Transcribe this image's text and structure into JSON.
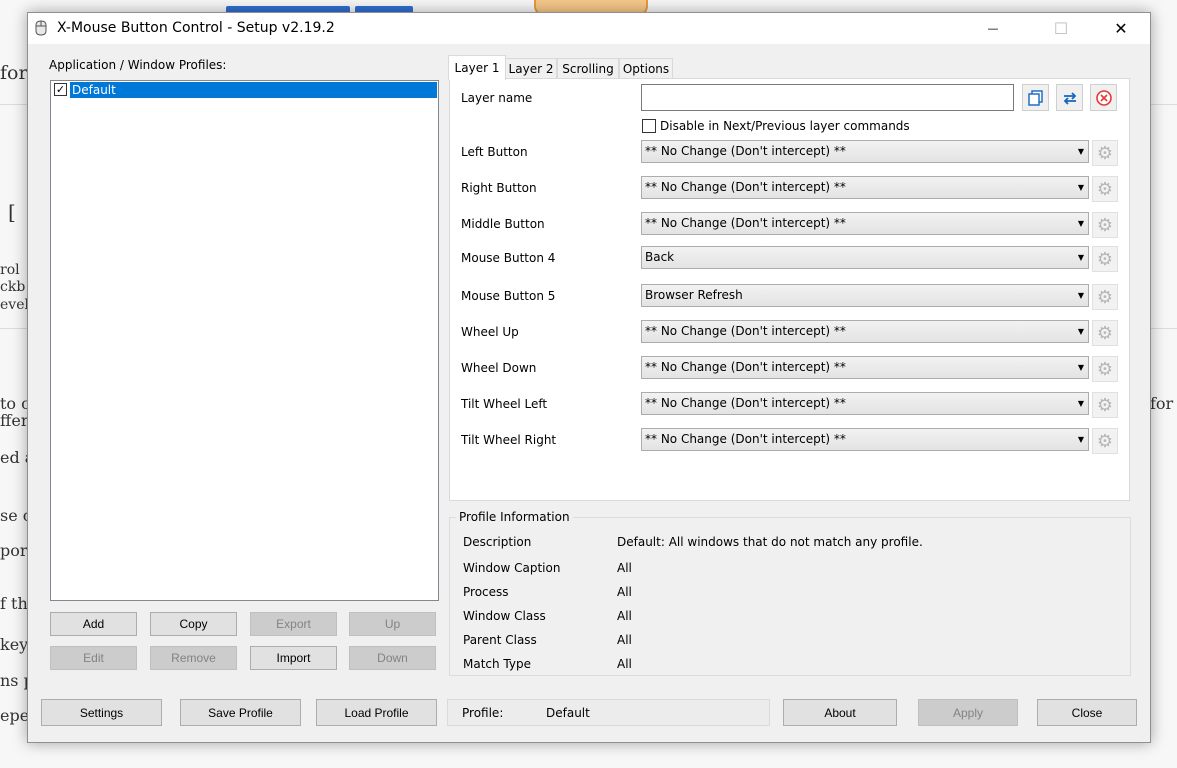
{
  "background_page": {
    "fragments": [
      "for",
      "[",
      "rol",
      "ckb",
      "evel",
      "to cr",
      "ffere",
      "ed a",
      "se o",
      "port",
      "f the",
      "key",
      "ns p",
      "epe",
      "for e"
    ]
  },
  "window": {
    "title": "X-Mouse Button Control - Setup v2.19.2",
    "minimize_glyph": "—",
    "maximize_glyph": "☐",
    "close_glyph": "✕"
  },
  "profiles": {
    "group_label": "Application / Window Profiles:",
    "items": [
      {
        "label": "Default",
        "checked": true,
        "check_glyph": "✓"
      }
    ],
    "buttons": {
      "add": "Add",
      "copy": "Copy",
      "export": "Export",
      "up": "Up",
      "edit": "Edit",
      "remove": "Remove",
      "import": "Import",
      "down": "Down"
    }
  },
  "tabs": [
    {
      "label": "Layer 1",
      "active": true
    },
    {
      "label": "Layer 2",
      "active": false
    },
    {
      "label": "Scrolling",
      "active": false
    },
    {
      "label": "Options",
      "active": false
    }
  ],
  "layer": {
    "name_label": "Layer name",
    "name_value": "",
    "disable_label": "Disable in Next/Previous layer commands",
    "disable_checked": false,
    "gear_glyph": "⚙",
    "arrow_glyph": "▼",
    "mappings": [
      {
        "label": "Left Button",
        "value": "** No Change (Don't intercept) **"
      },
      {
        "label": "Right Button",
        "value": "** No Change (Don't intercept) **"
      },
      {
        "label": "Middle Button",
        "value": "** No Change (Don't intercept) **"
      },
      {
        "label": "Mouse Button 4",
        "value": "Back"
      },
      {
        "label": "Mouse Button 5",
        "value": "Browser Refresh"
      },
      {
        "label": "Wheel Up",
        "value": "** No Change (Don't intercept) **"
      },
      {
        "label": "Wheel Down",
        "value": "** No Change (Don't intercept) **"
      },
      {
        "label": "Tilt Wheel Left",
        "value": "** No Change (Don't intercept) **"
      },
      {
        "label": "Tilt Wheel Right",
        "value": "** No Change (Don't intercept) **"
      }
    ]
  },
  "profile_info": {
    "title": "Profile Information",
    "rows": [
      {
        "label": "Description",
        "value": "Default: All windows that do not match any profile."
      },
      {
        "label": "Window Caption",
        "value": "All"
      },
      {
        "label": "Process",
        "value": "All"
      },
      {
        "label": "Window Class",
        "value": "All"
      },
      {
        "label": "Parent Class",
        "value": "All"
      },
      {
        "label": "Match Type",
        "value": "All"
      }
    ]
  },
  "footer": {
    "settings": "Settings",
    "save_profile": "Save Profile",
    "load_profile": "Load Profile",
    "profile_label": "Profile:",
    "profile_value": "Default",
    "about": "About",
    "apply": "Apply",
    "close": "Close"
  },
  "colors": {
    "selection": "#0078d7",
    "swap_icon": "#1565c0",
    "remove_icon": "#e53935"
  }
}
